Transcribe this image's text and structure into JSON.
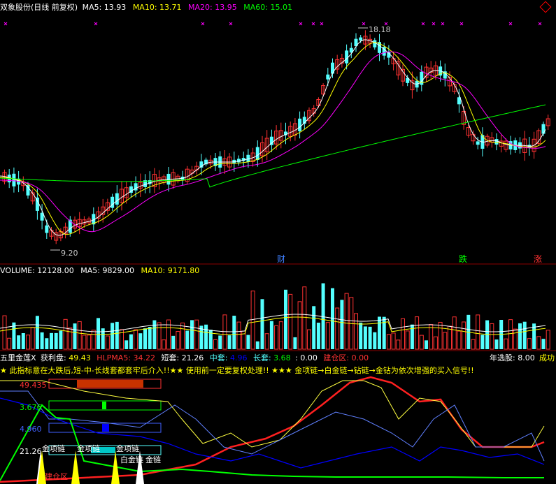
{
  "price_panel": {
    "title": "双象股份(日线 前复权)",
    "ma5": "MA5: 13.93",
    "ma10": "MA10: 13.71",
    "ma20": "MA20: 13.95",
    "ma60": "MA60: 15.01",
    "high_label": "18.18",
    "low_label": "9.20",
    "marker_cai": "财",
    "marker_die": "跌",
    "marker_zhang": "涨",
    "colors": {
      "ma5": "#ffffff",
      "ma10": "#ffff00",
      "ma20": "#ff00ff",
      "ma60": "#00ff00",
      "up": "#ff3232",
      "down": "#54ffff"
    }
  },
  "volume_panel": {
    "volume": "VOLUME: 12128.00",
    "ma5": "MA5: 9829.00",
    "ma10": "MA10: 9171.80"
  },
  "indicator_panel": {
    "name": "五里金莲X",
    "profit_label": "获利盘:",
    "profit_value": "49.43",
    "hlpma5": "HLPMA5: 34.22",
    "short_label": "短套:",
    "short_value": "21.26",
    "mid_label": "中套:",
    "mid_value": "4.96",
    "long_label": "长套:",
    "long_value": "3.68",
    "extra_value": ": 0.00",
    "build_label": "建仓区:",
    "build_value": "0.00",
    "year_pick": "年选股: 8.00",
    "success": "成功",
    "notice": "★ 此指标意在大跌后,短-中-长线套都套牢后介入!!★★ 使用前一定要复权处理!!  ★★★ 金项链→白金链→钻链→金钻为依次增强的买入信号!!",
    "bar_values": [
      "49.435",
      "3.676",
      "4.960",
      "21.26"
    ],
    "signal_labels": [
      "金项链",
      "金项链",
      "金项链",
      "白金链",
      "金链"
    ],
    "zone_label": "建仓区"
  }
}
